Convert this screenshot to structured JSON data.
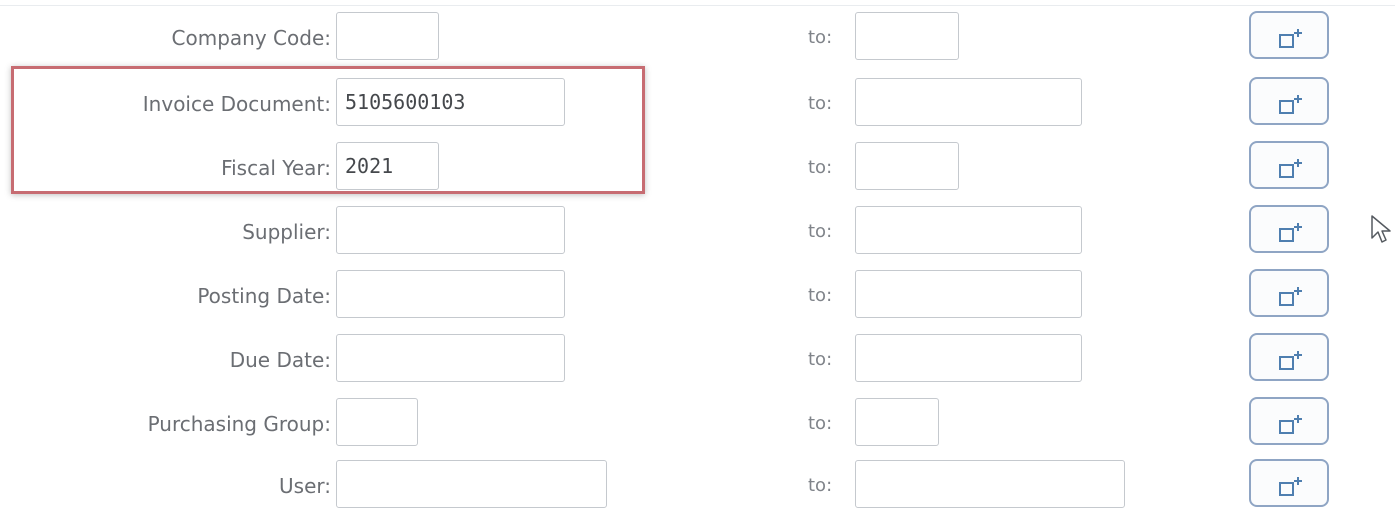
{
  "form": {
    "to_label": "to:",
    "rows": [
      {
        "label": "Company Code:",
        "from_value": "",
        "to_value": ""
      },
      {
        "label": "Invoice Document:",
        "from_value": "5105600103",
        "to_value": ""
      },
      {
        "label": "Fiscal Year:",
        "from_value": "2021",
        "to_value": ""
      },
      {
        "label": "Supplier:",
        "from_value": "",
        "to_value": ""
      },
      {
        "label": "Posting Date:",
        "from_value": "",
        "to_value": ""
      },
      {
        "label": "Due Date:",
        "from_value": "",
        "to_value": ""
      },
      {
        "label": "Purchasing Group:",
        "from_value": "",
        "to_value": ""
      },
      {
        "label": "User:",
        "from_value": "",
        "to_value": ""
      }
    ]
  },
  "icons": {
    "multiple_selection_button": "multiple-selection-icon",
    "cursor": "mouse-pointer-icon"
  },
  "colors": {
    "highlight_border": "#c76c72",
    "button_border": "#8fa5c4",
    "icon_color": "#4f7fb0"
  }
}
